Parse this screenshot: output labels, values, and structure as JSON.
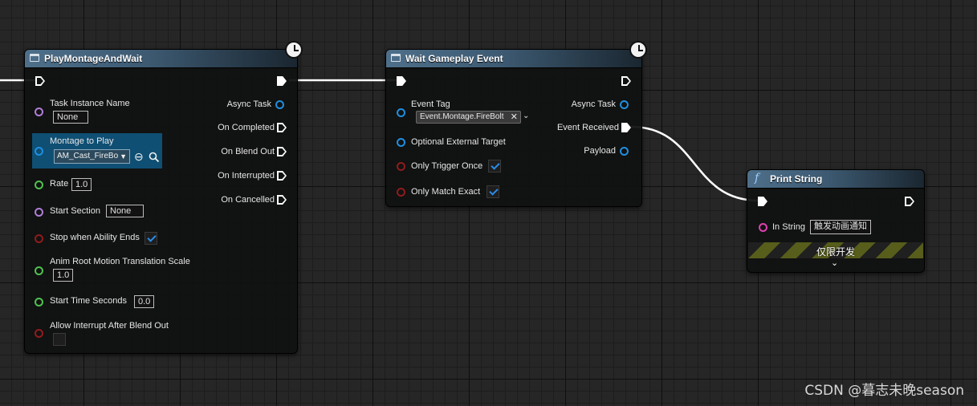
{
  "nodes": {
    "play_montage": {
      "title": "PlayMontageAndWait",
      "inputs": {
        "task_instance_name": {
          "label": "Task Instance Name",
          "value": "None"
        },
        "montage_to_play": {
          "label": "Montage to Play",
          "value": "AM_Cast_FireBo"
        },
        "rate": {
          "label": "Rate",
          "value": "1.0"
        },
        "start_section": {
          "label": "Start Section",
          "value": "None"
        },
        "stop_when_ability_ends": {
          "label": "Stop when Ability Ends",
          "checked": true
        },
        "anim_root_motion": {
          "label": "Anim Root Motion Translation Scale",
          "value": "1.0"
        },
        "start_time_seconds": {
          "label": "Start Time Seconds",
          "value": "0.0"
        },
        "allow_interrupt": {
          "label": "Allow Interrupt After Blend Out",
          "checked": false
        }
      },
      "outputs": {
        "async_task": "Async Task",
        "on_completed": "On Completed",
        "on_blend_out": "On Blend Out",
        "on_interrupted": "On Interrupted",
        "on_cancelled": "On Cancelled"
      }
    },
    "wait_gameplay_event": {
      "title": "Wait Gameplay Event",
      "inputs": {
        "event_tag": {
          "label": "Event Tag",
          "value": "Event.Montage.FireBolt"
        },
        "optional_external_target": {
          "label": "Optional External Target"
        },
        "only_trigger_once": {
          "label": "Only Trigger Once",
          "checked": true
        },
        "only_match_exact": {
          "label": "Only Match Exact",
          "checked": true
        }
      },
      "outputs": {
        "async_task": "Async Task",
        "event_received": "Event Received",
        "payload": "Payload"
      }
    },
    "print_string": {
      "title": "Print String",
      "inputs": {
        "in_string": {
          "label": "In String",
          "value": "触发动画通知"
        }
      },
      "dev_only_banner": "仅限开发"
    }
  },
  "icons": {
    "node_header": "blueprint-node-icon",
    "function": "function-icon",
    "latent": "clock-icon",
    "browse": "browse-icon",
    "search": "search-icon"
  },
  "colors": {
    "exec_wire": "#ffffff",
    "object_pin": "#1f8fe0",
    "struct_name_pin": "#b07ed8",
    "float_pin": "#4fc24f",
    "bool_pin": "#8f1c1c",
    "string_pin": "#e040b0",
    "node_header": "#3d5a72"
  },
  "watermark": "CSDN @暮志未晚season"
}
